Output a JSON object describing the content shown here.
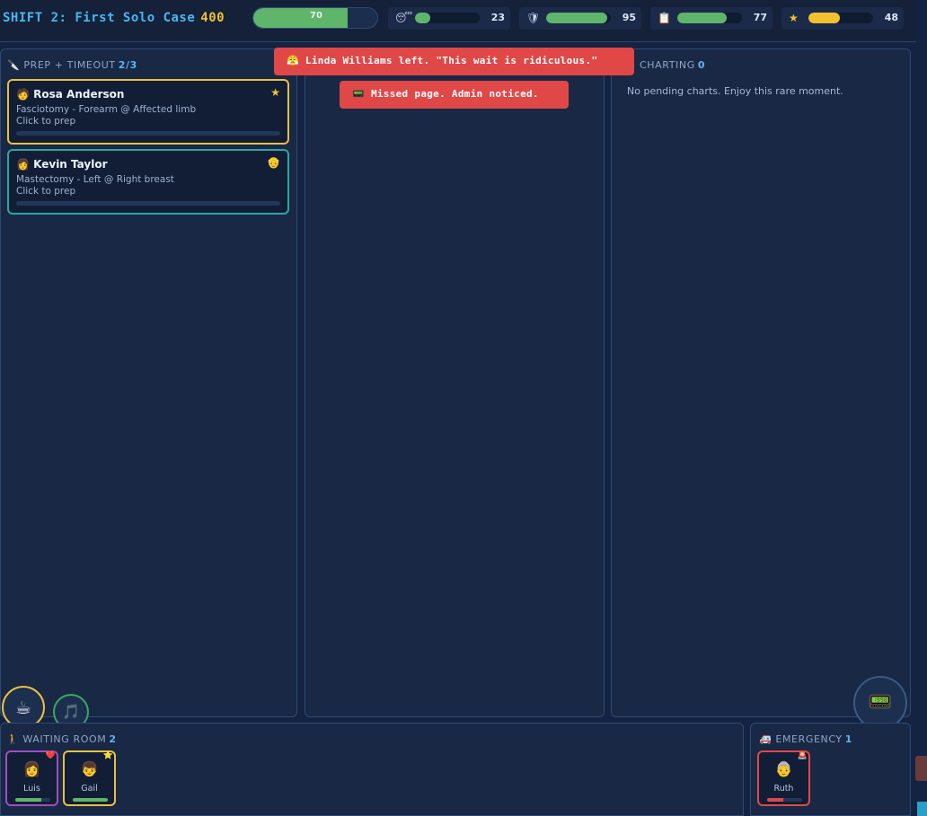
{
  "header": {
    "shift_title": "SHIFT 2: First Solo Case",
    "score": "400",
    "main_meter": {
      "value": "70",
      "fraction": 0.76,
      "color": "#5fb56a"
    },
    "stats": [
      {
        "icon": "sleepy-face-icon",
        "glyph": "😴",
        "value": "23",
        "fraction": 0.23,
        "color": "#5fb56a"
      },
      {
        "icon": "shield-icon",
        "glyph": "🛡",
        "value": "95",
        "fraction": 0.95,
        "color": "#5fb56a"
      },
      {
        "icon": "clipboard-icon",
        "glyph": "📋",
        "value": "77",
        "fraction": 0.77,
        "color": "#5fb56a"
      },
      {
        "icon": "star-icon",
        "glyph": "★",
        "value": "48",
        "fraction": 0.48,
        "color": "#f2c22e"
      }
    ]
  },
  "prep_panel": {
    "icon": "scalpel-icon",
    "glyph": "🔪",
    "title": "PREP + TIMEOUT",
    "count": "2/3",
    "cards": [
      {
        "face": "🧑",
        "name": "Rosa Anderson",
        "procedure": "Fasciotomy - Forearm @ Affected limb",
        "action": "Click to prep",
        "badge": "★",
        "badge_icon": "star-icon"
      },
      {
        "face": "👩",
        "name": "Kevin Taylor",
        "procedure": "Mastectomy - Left @ Right breast",
        "action": "Click to prep",
        "badge": "👴",
        "badge_icon": "elderly-icon"
      }
    ]
  },
  "toasts": [
    {
      "glyph": "😤",
      "text": "Linda Williams left. \"This wait is ridiculous.\""
    },
    {
      "glyph": "📟",
      "text": "Missed page. Admin noticed."
    }
  ],
  "charting_panel": {
    "title": "CHARTING",
    "count": "0",
    "empty_text": "No pending charts. Enjoy this rare moment."
  },
  "actions": {
    "coffee": "☕",
    "music": "🎵",
    "pager": "📟"
  },
  "waiting_room": {
    "glyph": "🚶",
    "title": "WAITING ROOM",
    "count": "2",
    "patients": [
      {
        "face": "👩",
        "name": "Luis",
        "tag": "❤️",
        "bar_fraction": 0.75,
        "bar_color": "#5fb56a",
        "border": "#a04ec0"
      },
      {
        "face": "👦",
        "name": "Gail",
        "tag": "⭐",
        "bar_fraction": 1.0,
        "bar_color": "#5fb56a",
        "border": "#e8c040"
      }
    ]
  },
  "emergency": {
    "glyph": "🚑",
    "title": "EMERGENCY",
    "count": "1",
    "patients": [
      {
        "face": "👵",
        "name": "Ruth",
        "tag": "🚨",
        "bar_fraction": 0.45,
        "bar_color": "#e04848",
        "border": "#e04848"
      }
    ]
  }
}
